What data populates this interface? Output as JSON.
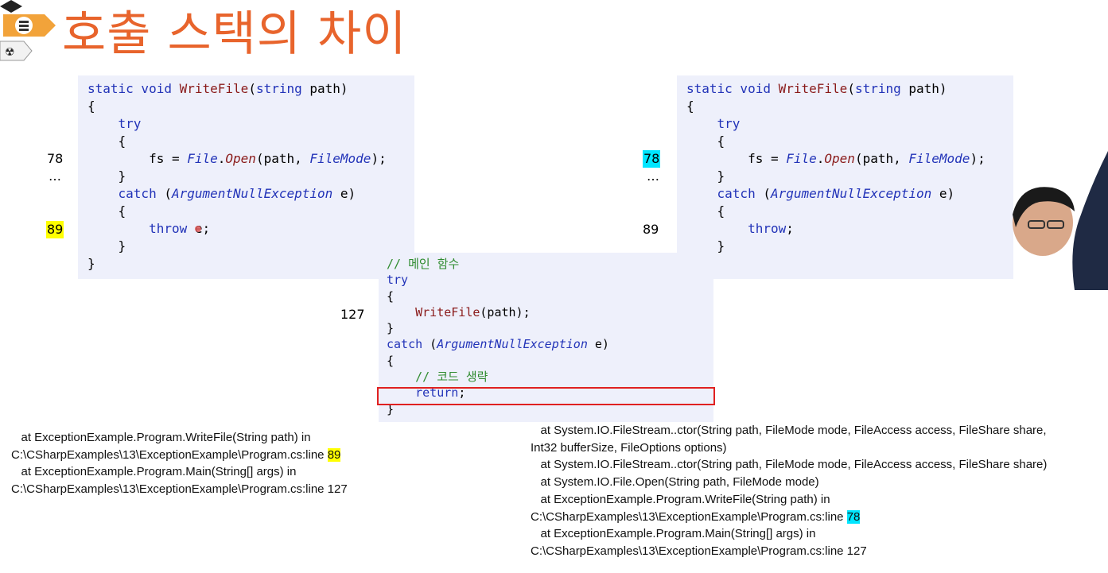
{
  "slide": {
    "title": "호출 스택의 차이",
    "icon": "stacked-layers-icon"
  },
  "left_code": {
    "lines": [
      [
        "static void ",
        "WriteFile",
        "(",
        "string",
        " path)"
      ],
      "{",
      "    try",
      "    {",
      "        fs = File.Open(path, FileMode);",
      "    }",
      "    catch (ArgumentNullException e)",
      "    {",
      "        throw e;",
      "    }",
      "}"
    ],
    "line_labels": {
      "l78": "78",
      "ellipsis": "…",
      "l89": "89"
    }
  },
  "right_code": {
    "line_labels": {
      "l78": "78",
      "ellipsis": "…",
      "l89": "89"
    }
  },
  "main_code": {
    "comment_main": "// 메인 함수",
    "comment_omit": "// 코드 생략",
    "line_label": "127"
  },
  "left_trace": {
    "lines": [
      "   at ExceptionExample.Program.WriteFile(String path) in",
      "C:\\CSharpExamples\\13\\ExceptionExample\\Program.cs:line ",
      "   at ExceptionExample.Program.Main(String[] args) in",
      "C:\\CSharpExamples\\13\\ExceptionExample\\Program.cs:line 127"
    ],
    "highlight": "89"
  },
  "right_trace": {
    "lines": [
      "   at System.IO.FileStream..ctor(String path, FileMode mode, FileAccess access, FileShare share,",
      "Int32 bufferSize, FileOptions options)",
      "   at System.IO.FileStream..ctor(String path, FileMode mode, FileAccess access, FileShare share)",
      "   at System.IO.File.Open(String path, FileMode mode)",
      "   at ExceptionExample.Program.WriteFile(String path) in",
      "C:\\CSharpExamples\\13\\ExceptionExample\\Program.cs:line ",
      "   at ExceptionExample.Program.Main(String[] args) in",
      "C:\\CSharpExamples\\13\\ExceptionExample\\Program.cs:line 127"
    ],
    "highlight": "78"
  },
  "colors": {
    "title": "#e8642c",
    "keyword": "#2233b8",
    "method": "#8a1a1a",
    "comment": "#2e8b2e",
    "highlight_yellow": "#ffff00",
    "highlight_cyan": "#00e5ff",
    "box_red": "#e02020"
  }
}
